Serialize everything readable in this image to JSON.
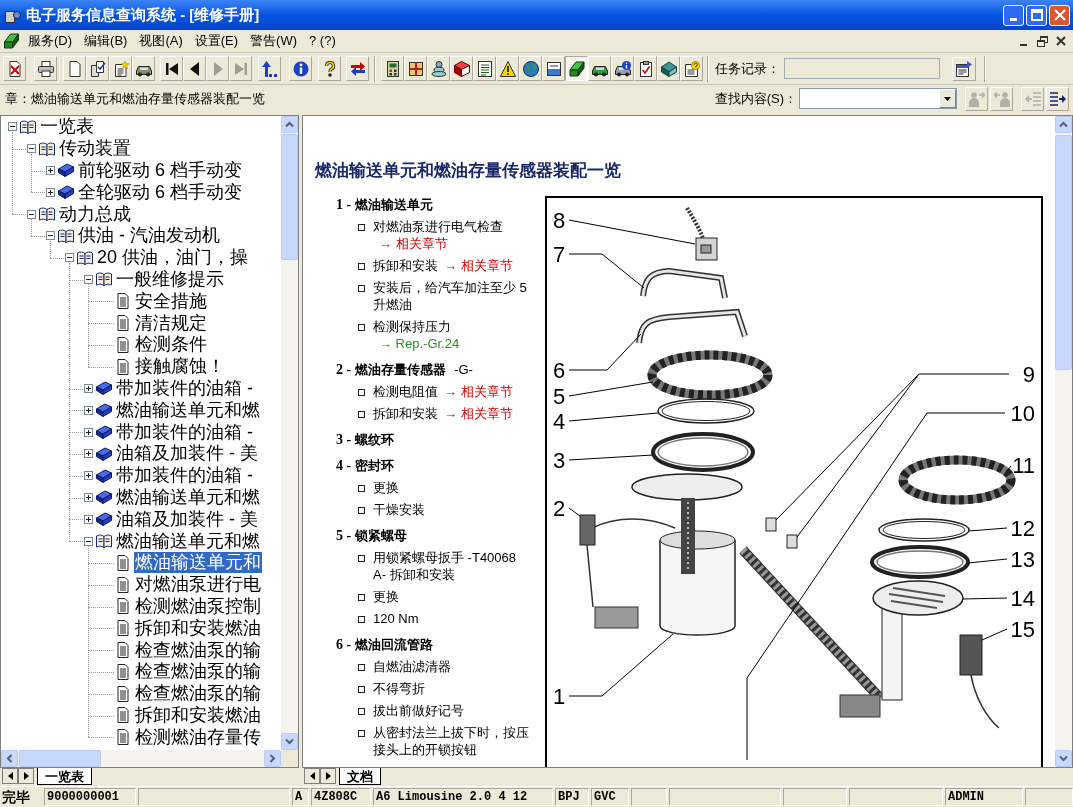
{
  "window": {
    "title": "电子服务信息查询系统 - [维修手册]"
  },
  "menu": [
    "服务(D)",
    "编辑(B)",
    "视图(A)",
    "设置(E)",
    "警告(W)",
    "? (?)"
  ],
  "toolbar": [
    {
      "disabled": false,
      "pressed": false
    },
    {
      "disabled": false,
      "pressed": false
    },
    {
      "disabled": false,
      "pressed": false
    },
    {
      "disabled": false,
      "pressed": false
    },
    {
      "disabled": false,
      "pressed": false
    },
    {
      "disabled": false,
      "pressed": false
    },
    {
      "disabled": false,
      "pressed": false
    },
    {
      "disabled": false,
      "pressed": false
    },
    {
      "disabled": true,
      "pressed": false
    },
    {
      "disabled": true,
      "pressed": false
    },
    {
      "disabled": false,
      "pressed": false
    },
    {
      "disabled": false,
      "pressed": false
    },
    {
      "disabled": false,
      "pressed": false
    },
    {
      "disabled": false,
      "pressed": false
    },
    {
      "disabled": false,
      "pressed": false
    },
    {
      "disabled": false,
      "pressed": false
    },
    {
      "disabled": false,
      "pressed": false
    },
    {
      "disabled": false,
      "pressed": false
    },
    {
      "disabled": false,
      "pressed": false
    },
    {
      "disabled": false,
      "pressed": false
    },
    {
      "disabled": false,
      "pressed": false
    },
    {
      "disabled": false,
      "pressed": false
    },
    {
      "disabled": false,
      "pressed": true
    },
    {
      "disabled": false,
      "pressed": false
    },
    {
      "disabled": false,
      "pressed": false
    },
    {
      "disabled": false,
      "pressed": false
    },
    {
      "disabled": false,
      "pressed": false
    },
    {
      "disabled": false,
      "pressed": false
    }
  ],
  "task_record": {
    "label": "任务记录："
  },
  "chapter": "章：燃油输送单元和燃油存量传感器装配一览",
  "search": {
    "label": "查找内容(S)：",
    "buttons": [
      {
        "disabled": true
      },
      {
        "disabled": true
      },
      {
        "disabled": true
      },
      {
        "disabled": false
      }
    ]
  },
  "tree": [
    {
      "label": "一览表",
      "kind": "book",
      "expanded": true,
      "selected": false,
      "children": [
        {
          "label": "传动装置",
          "kind": "book",
          "expanded": true,
          "selected": false,
          "children": [
            {
              "label": "前轮驱动 6 档手动变",
              "kind": "book",
              "expanded": false,
              "selected": false
            },
            {
              "label": "全轮驱动 6 档手动变",
              "kind": "book",
              "expanded": false,
              "selected": false
            }
          ]
        },
        {
          "label": "动力总成",
          "kind": "book",
          "expanded": true,
          "selected": false,
          "children": [
            {
              "label": "供油 - 汽油发动机",
              "kind": "book",
              "expanded": true,
              "selected": false,
              "children": [
                {
                  "label": "20 供油，油门，操",
                  "kind": "book",
                  "expanded": true,
                  "selected": false,
                  "children": [
                    {
                      "label": "一般维修提示",
                      "kind": "book",
                      "expanded": true,
                      "selected": false,
                      "children": [
                        {
                          "label": "安全措施",
                          "kind": "page",
                          "selected": false
                        },
                        {
                          "label": "清洁规定",
                          "kind": "page",
                          "selected": false
                        },
                        {
                          "label": "检测条件",
                          "kind": "page",
                          "selected": false
                        },
                        {
                          "label": "接触腐蚀！",
                          "kind": "page",
                          "selected": false
                        }
                      ]
                    },
                    {
                      "label": "带加装件的油箱 -",
                      "kind": "book",
                      "expanded": false,
                      "selected": false
                    },
                    {
                      "label": "燃油输送单元和燃",
                      "kind": "book",
                      "expanded": false,
                      "selected": false
                    },
                    {
                      "label": "带加装件的油箱 -",
                      "kind": "book",
                      "expanded": false,
                      "selected": false
                    },
                    {
                      "label": "油箱及加装件 - 美",
                      "kind": "book",
                      "expanded": false,
                      "selected": false
                    },
                    {
                      "label": "带加装件的油箱 -",
                      "kind": "book",
                      "expanded": false,
                      "selected": false
                    },
                    {
                      "label": "燃油输送单元和燃",
                      "kind": "book",
                      "expanded": false,
                      "selected": false
                    },
                    {
                      "label": "油箱及加装件 - 美",
                      "kind": "book",
                      "expanded": false,
                      "selected": false
                    },
                    {
                      "label": "燃油输送单元和燃",
                      "kind": "book",
                      "expanded": true,
                      "selected": false,
                      "children": [
                        {
                          "label": "燃油输送单元和",
                          "kind": "page",
                          "selected": true
                        },
                        {
                          "label": "对燃油泵进行电",
                          "kind": "page",
                          "selected": false
                        },
                        {
                          "label": "检测燃油泵控制",
                          "kind": "page",
                          "selected": false
                        },
                        {
                          "label": "拆卸和安装燃油",
                          "kind": "page",
                          "selected": false
                        },
                        {
                          "label": "检查燃油泵的输",
                          "kind": "page",
                          "selected": false
                        },
                        {
                          "label": "检查燃油泵的输",
                          "kind": "page",
                          "selected": false
                        },
                        {
                          "label": "检查燃油泵的输",
                          "kind": "page",
                          "selected": false
                        },
                        {
                          "label": "拆卸和安装燃油",
                          "kind": "page",
                          "selected": false
                        },
                        {
                          "label": "检测燃油存量传",
                          "kind": "page",
                          "selected": false
                        }
                      ]
                    }
                  ]
                }
              ]
            }
          ]
        }
      ]
    }
  ],
  "tree_tabs": [
    {
      "label": "一览表",
      "selected": true
    }
  ],
  "document": {
    "title": "燃油输送单元和燃油存量传感器装配一览",
    "items": [
      {
        "number": "1 -",
        "title": "燃油输送单元",
        "notes": [
          {
            "text": "对燃油泵进行电气检查",
            "link": {
              "text": "→ 相关章节",
              "kind": "chapter"
            }
          },
          {
            "text": "拆卸和安装",
            "link": {
              "text": "→ 相关章节",
              "kind": "chapter"
            }
          },
          {
            "text": "安装后，给汽车加注至少 5 升燃油"
          },
          {
            "text": "检测保持压力",
            "link": {
              "text": "→ Rep.-Gr.24",
              "kind": "repair_group"
            }
          }
        ]
      },
      {
        "number": "2 -",
        "title": "燃油存量传感器",
        "code": "-G-",
        "notes": [
          {
            "text": "检测电阻值",
            "link": {
              "text": "→ 相关章节",
              "kind": "chapter"
            }
          },
          {
            "text": "拆卸和安装",
            "link": {
              "text": "→ 相关章节",
              "kind": "chapter"
            }
          }
        ]
      },
      {
        "number": "3 -",
        "title": "螺纹环"
      },
      {
        "number": "4 -",
        "title": "密封环",
        "notes": [
          {
            "text": "更换"
          },
          {
            "text": "干燥安装"
          }
        ]
      },
      {
        "number": "5 -",
        "title": "锁紧螺母",
        "notes": [
          {
            "text": "用锁紧螺母扳手 -T40068 A- 拆卸和安装"
          },
          {
            "text": "更换"
          },
          {
            "text": "120 Nm"
          }
        ]
      },
      {
        "number": "6 -",
        "title": "燃油回流管路",
        "notes": [
          {
            "text": "自燃油滤清器"
          },
          {
            "text": "不得弯折"
          },
          {
            "text": "拔出前做好记号"
          },
          {
            "text": "从密封法兰上拔下时，按压接头上的开锁按钮"
          }
        ]
      }
    ],
    "diagram": {
      "callouts": [
        "8",
        "7",
        "6",
        "5",
        "4",
        "3",
        "2",
        "1",
        "9",
        "10",
        "11",
        "12",
        "13",
        "14",
        "15"
      ]
    }
  },
  "doc_tabs": [
    {
      "label": "文档",
      "selected": true
    }
  ],
  "status_bar": {
    "message": "完毕",
    "fields": [
      "9000000001",
      "A",
      "4Z808C",
      "A6 Limousine 2.0 4 12",
      "BPJ",
      "GVC",
      "ADMIN"
    ]
  }
}
